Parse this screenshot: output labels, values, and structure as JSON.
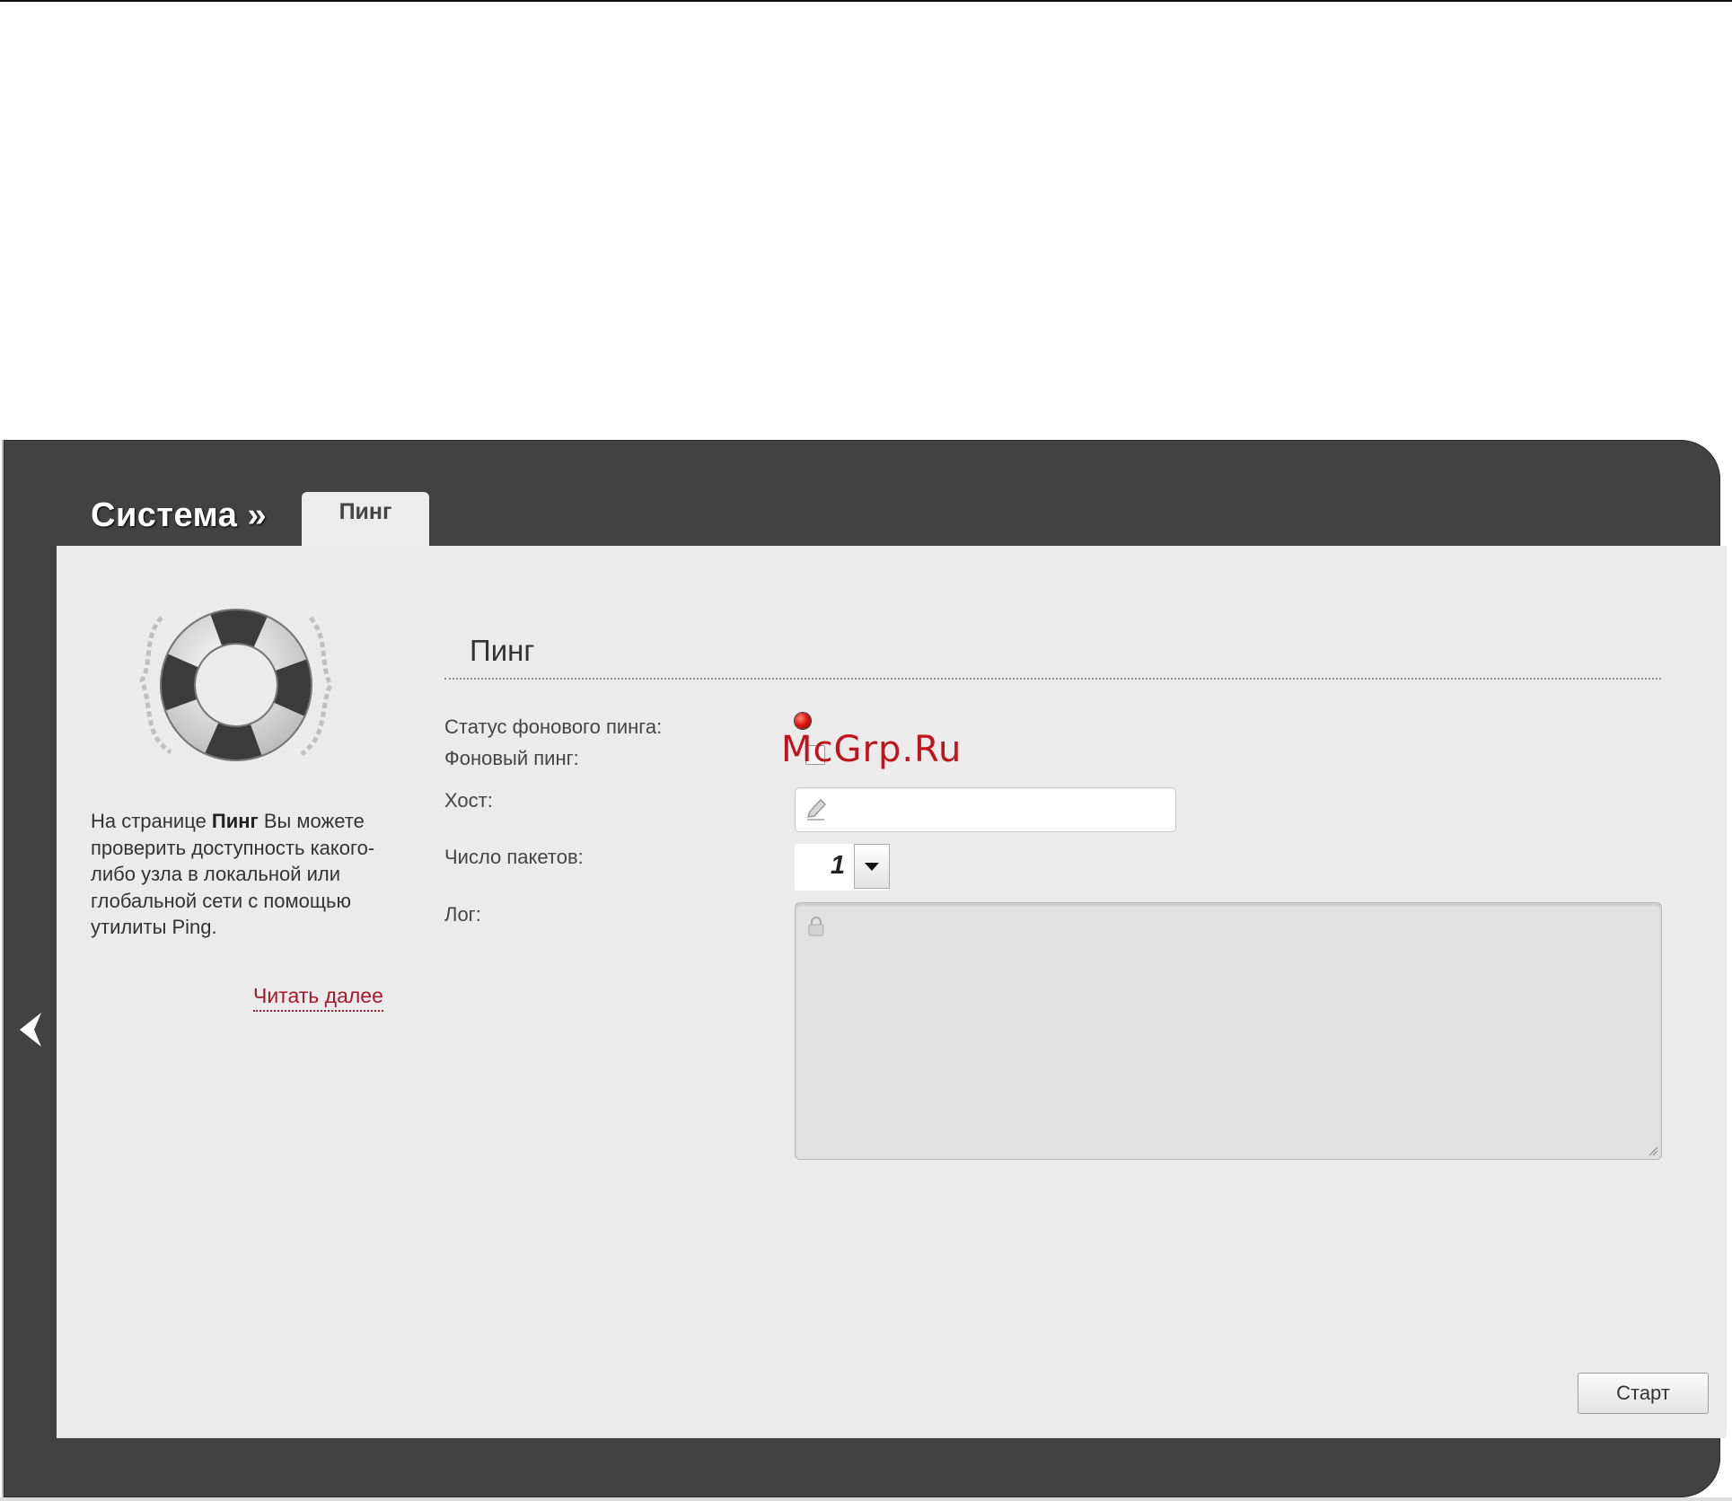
{
  "breadcrumb": {
    "section": "Система »"
  },
  "tabs": [
    {
      "label": "Пинг",
      "active": true
    }
  ],
  "sidebar": {
    "text_prefix": "На странице ",
    "text_bold": "Пинг",
    "text_suffix": " Вы можете проверить доступность какого-либо узла в локальной или глобальной сети с помощью утилиты Ping.",
    "read_more": "Читать далее"
  },
  "form": {
    "title": "Пинг",
    "status_label": "Статус фонового пинга:",
    "status_color": "#e01a12",
    "background_ping_label": "Фоновый пинг:",
    "background_ping_checked": false,
    "host_label": "Хост:",
    "host_value": "",
    "packets_label": "Число пакетов:",
    "packets_value": "1",
    "log_label": "Лог:",
    "log_value": ""
  },
  "watermark": "McGrp.Ru",
  "actions": {
    "start_label": "Старт"
  },
  "icons": {
    "back": "chevron-left-icon",
    "help": "lifebuoy-icon",
    "edit": "pencil-icon",
    "readonly": "lock-icon",
    "dropdown": "caret-down-icon"
  }
}
